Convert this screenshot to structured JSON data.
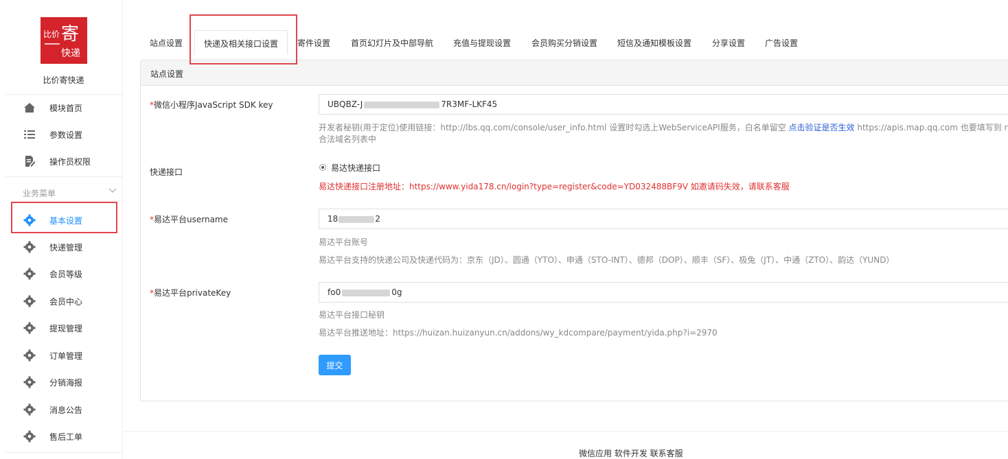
{
  "brand": {
    "logo_text_small": "比价",
    "logo_text_big": "寄",
    "logo_text_bottom": "快递",
    "app_name": "比价寄快递"
  },
  "sidebar": {
    "top_items": [
      {
        "label": "模块首页",
        "icon": "home-icon"
      },
      {
        "label": "参数设置",
        "icon": "list-icon"
      },
      {
        "label": "操作员权限",
        "icon": "edit-doc-icon"
      }
    ],
    "group_title": "业务菜单",
    "group_items": [
      {
        "label": "基本设置",
        "icon": "gear-icon",
        "active": true
      },
      {
        "label": "快递管理",
        "icon": "gear-icon"
      },
      {
        "label": "会员等级",
        "icon": "gear-icon"
      },
      {
        "label": "会员中心",
        "icon": "gear-icon"
      },
      {
        "label": "提现管理",
        "icon": "gear-icon"
      },
      {
        "label": "订单管理",
        "icon": "gear-icon"
      },
      {
        "label": "分销海报",
        "icon": "gear-icon"
      },
      {
        "label": "消息公告",
        "icon": "gear-icon"
      },
      {
        "label": "售后工单",
        "icon": "gear-icon"
      }
    ]
  },
  "tabs": [
    {
      "label": "站点设置"
    },
    {
      "label": "快递及相关接口设置",
      "active": true
    },
    {
      "label": "寄件设置"
    },
    {
      "label": "首页幻灯片及中部导航"
    },
    {
      "label": "充值与提现设置"
    },
    {
      "label": "会员购买分销设置"
    },
    {
      "label": "短信及通知模板设置"
    },
    {
      "label": "分享设置"
    },
    {
      "label": "广告设置"
    }
  ],
  "panel": {
    "title": "站点设置",
    "sdk_key": {
      "required_mark": "*",
      "label": "微信小程序JavaScript SDK key",
      "value_prefix": "UBQBZ-J",
      "value_suffix": "7R3MF-LKF45",
      "help_part1": "开发者秘钥(用于定位)使用链接：http://lbs.qq.com/console/user_info.html 设置时勾选上WebServiceAPI服务，白名单留空 ",
      "help_link": "点击验证是否生效",
      "help_part2": " https://apis.map.qq.com 也要填写到 requ",
      "help_line2": "合法域名列表中"
    },
    "express_api": {
      "label": "快递接口",
      "option": "易达快递接口",
      "notice": "易达快递接口注册地址：https://www.yida178.cn/login?type=register&code=YD032488BF9V 如邀请码失效，请联系客服"
    },
    "username": {
      "required_mark": "*",
      "label": "易达平台username",
      "value_prefix": "18",
      "value_suffix": "2",
      "help1": "易达平台账号",
      "help2": "易达平台支持的快递公司及快递代码为：京东（JD）、圆通（YTO）、申通（STO-INT）、德邦（DOP）、顺丰（SF）、极兔（JT）、中通（ZTO）、韵达（YUND）"
    },
    "private_key": {
      "required_mark": "*",
      "label": "易达平台privateKey",
      "value_prefix": "fo0",
      "value_suffix": "0g",
      "help1": "易达平台接口秘钥",
      "help2": "易达平台推送地址：https://huizan.huizanyun.cn/addons/wy_kdcompare/payment/yida.php?i=2970"
    },
    "submit_label": "提交"
  },
  "footer": {
    "text": "微信应用 软件开发 联系客服"
  },
  "colors": {
    "accent": "#2f9bff",
    "highlight": "#e0464b",
    "required": "#e03030",
    "logo_bg": "#d4232b"
  }
}
